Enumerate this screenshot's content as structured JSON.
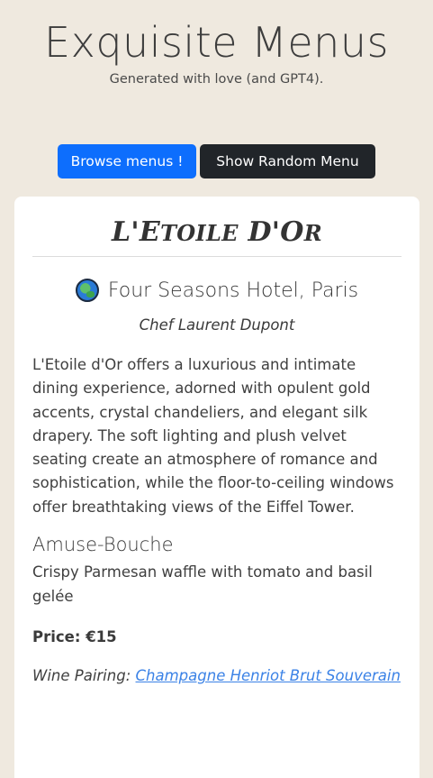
{
  "header": {
    "title": "Exquisite Menus",
    "subtitle": "Generated with love (and GPT4)."
  },
  "actions": {
    "browse_label": "Browse menus !",
    "random_label": "Show Random Menu"
  },
  "restaurant": {
    "name_first": "L'E",
    "name_small1": "TOILE",
    "name_mid": " D'O",
    "name_small2": "R",
    "location_icon": "globe-icon",
    "location": "Four Seasons Hotel, Paris",
    "chef": "Chef Laurent Dupont",
    "description": "L'Etoile d'Or offers a luxurious and intimate dining experience, adorned with opulent gold accents, crystal chandeliers, and elegant silk drapery. The soft lighting and plush velvet seating create an atmosphere of romance and sophistication, while the floor-to-ceiling windows offer breathtaking views of the Eiffel Tower."
  },
  "course": {
    "title": "Amuse-Bouche",
    "description": "Crispy Parmesan waffle with tomato and basil gelée",
    "price": "Price: €15",
    "wine_label": "Wine Pairing: ",
    "wine_link": "Champagne Henriot Brut Souverain"
  },
  "colors": {
    "background": "#efe9df",
    "primary_button": "#0d6efd",
    "dark_button": "#212529",
    "link": "#3b82e6"
  }
}
